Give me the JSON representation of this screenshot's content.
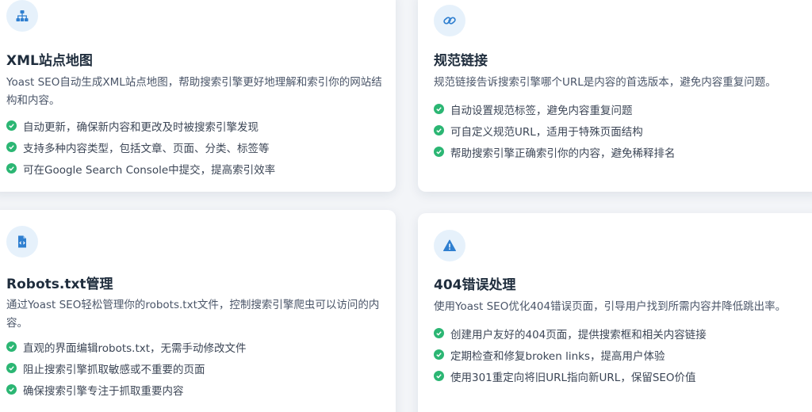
{
  "cards": [
    {
      "icon": "sitemap-icon",
      "title": "XML站点地图",
      "description": "Yoast SEO自动生成XML站点地图，帮助搜索引擎更好地理解和索引你的网站结构和内容。",
      "features": [
        "自动更新，确保新内容和更改及时被搜索引擎发现",
        "支持多种内容类型，包括文章、页面、分类、标签等",
        "可在Google Search Console中提交，提高索引效率"
      ]
    },
    {
      "icon": "link-icon",
      "title": "规范链接",
      "description": "规范链接告诉搜索引擎哪个URL是内容的首选版本，避免内容重复问题。",
      "features": [
        "自动设置规范标签，避免内容重复问题",
        "可自定义规范URL，适用于特殊页面结构",
        "帮助搜索引擎正确索引你的内容，避免稀释排名"
      ]
    },
    {
      "icon": "code-file-icon",
      "title": "Robots.txt管理",
      "description": "通过Yoast SEO轻松管理你的robots.txt文件，控制搜索引擎爬虫可以访问的内容。",
      "features": [
        "直观的界面编辑robots.txt，无需手动修改文件",
        "阻止搜索引擎抓取敏感或不重要的页面",
        "确保搜索引擎专注于抓取重要内容"
      ]
    },
    {
      "icon": "warning-icon",
      "title": "404错误处理",
      "description": "使用Yoast SEO优化404错误页面，引导用户找到所需内容并降低跳出率。",
      "features": [
        "创建用户友好的404页面，提供搜索框和相关内容链接",
        "定期检查和修复broken links，提高用户体验",
        "使用301重定向将旧URL指向新URL，保留SEO价值"
      ]
    }
  ],
  "colors": {
    "accent": "#2f7fd0",
    "icon_bg": "#e6f1fb",
    "check": "#2bb673",
    "title": "#1f2d3d"
  }
}
